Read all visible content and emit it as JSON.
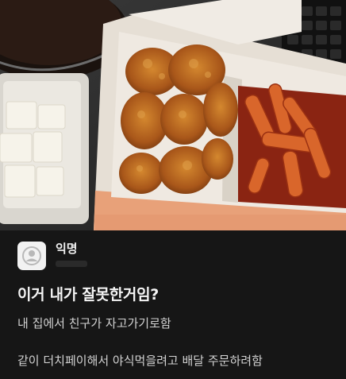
{
  "photo": {
    "alt": "",
    "colors": {
      "chicken": "#b4641f",
      "tteokbokki": "#c1441b",
      "box": "#e9e4dd",
      "radish": "#f3efe3"
    }
  },
  "post": {
    "author": "익명",
    "avatar_icon": "default-profile-icon",
    "title": "이거 내가 잘못한거임?",
    "body_lines": [
      "내 집에서 친구가 자고가기로함",
      "같이 더치페이해서 야식먹을려고 배달 주문하려함"
    ]
  }
}
